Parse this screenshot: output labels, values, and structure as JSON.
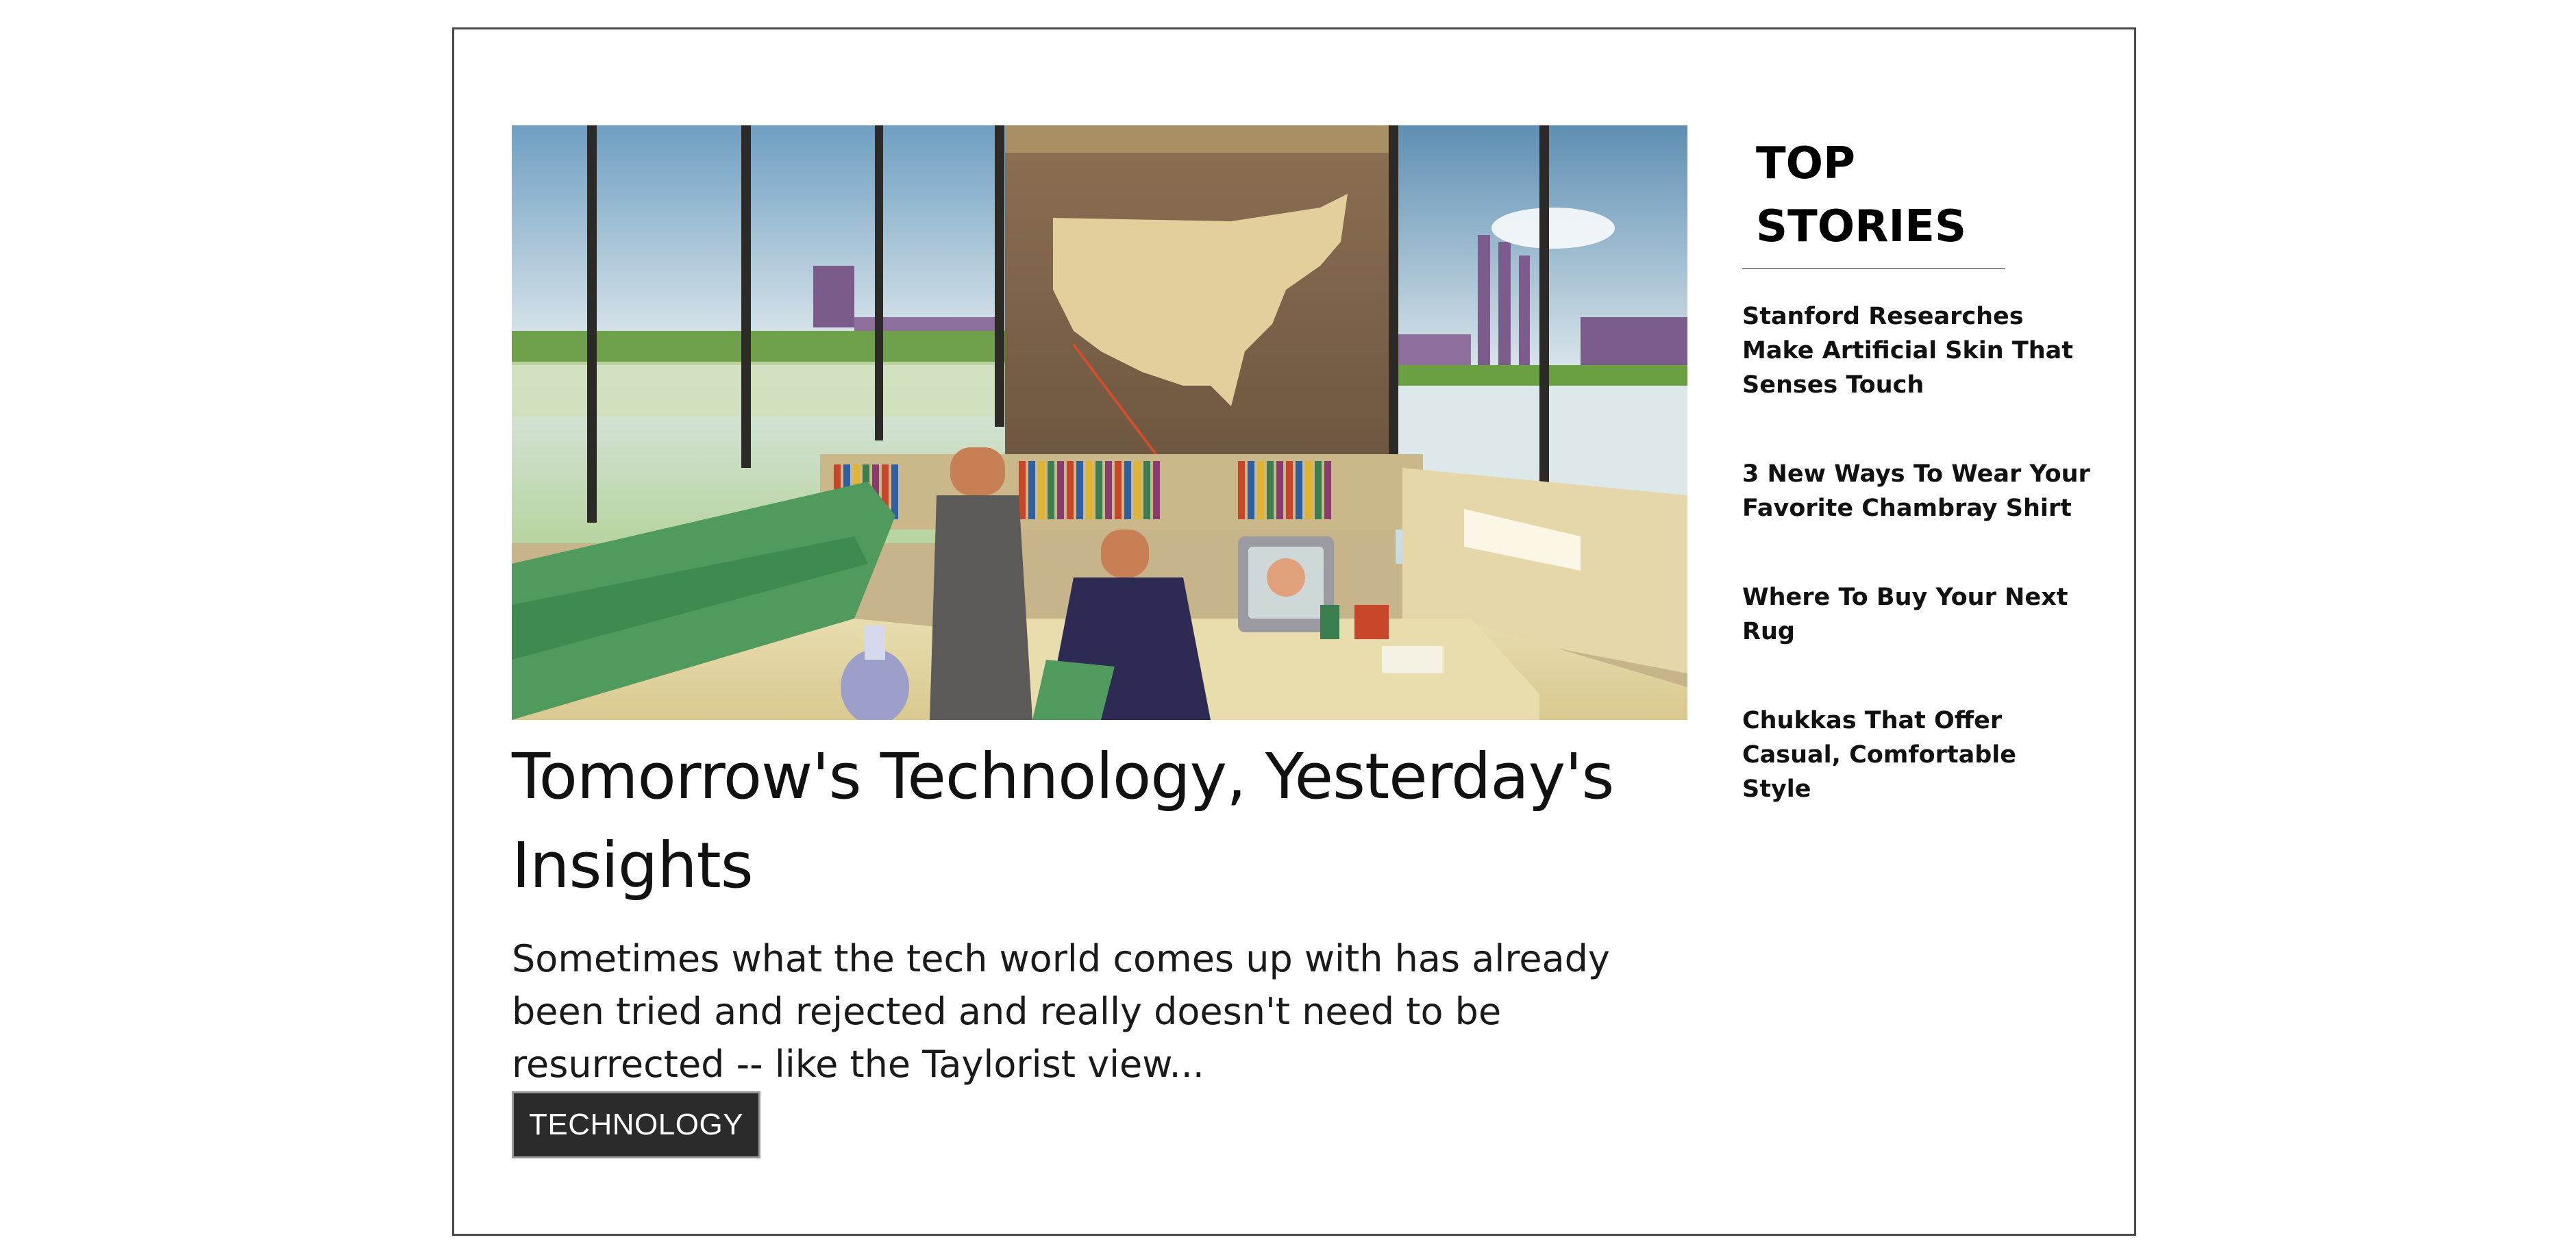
{
  "article": {
    "headline": "Tomorrow's Technology, Yesterday's Insights",
    "summary": "Sometimes what the tech world comes up with has already been tried and rejected and really doesn't need to be resurrected -- like the Taylorist view...",
    "category": "TECHNOLOGY",
    "image_description": "retro-illustration-office"
  },
  "sidebar": {
    "title": "TOP STORIES",
    "stories": [
      {
        "title": "Stanford Researches Make Artificial Skin That Senses Touch"
      },
      {
        "title": "3 New Ways To Wear Your Favorite Chambray Shirt"
      },
      {
        "title": "Where To Buy Your Next Rug"
      },
      {
        "title": "Chukkas That Offer Casual, Comfortable Style"
      }
    ]
  },
  "colors": {
    "tag_background": "#2b2b2b",
    "border": "#4a4a4a"
  }
}
